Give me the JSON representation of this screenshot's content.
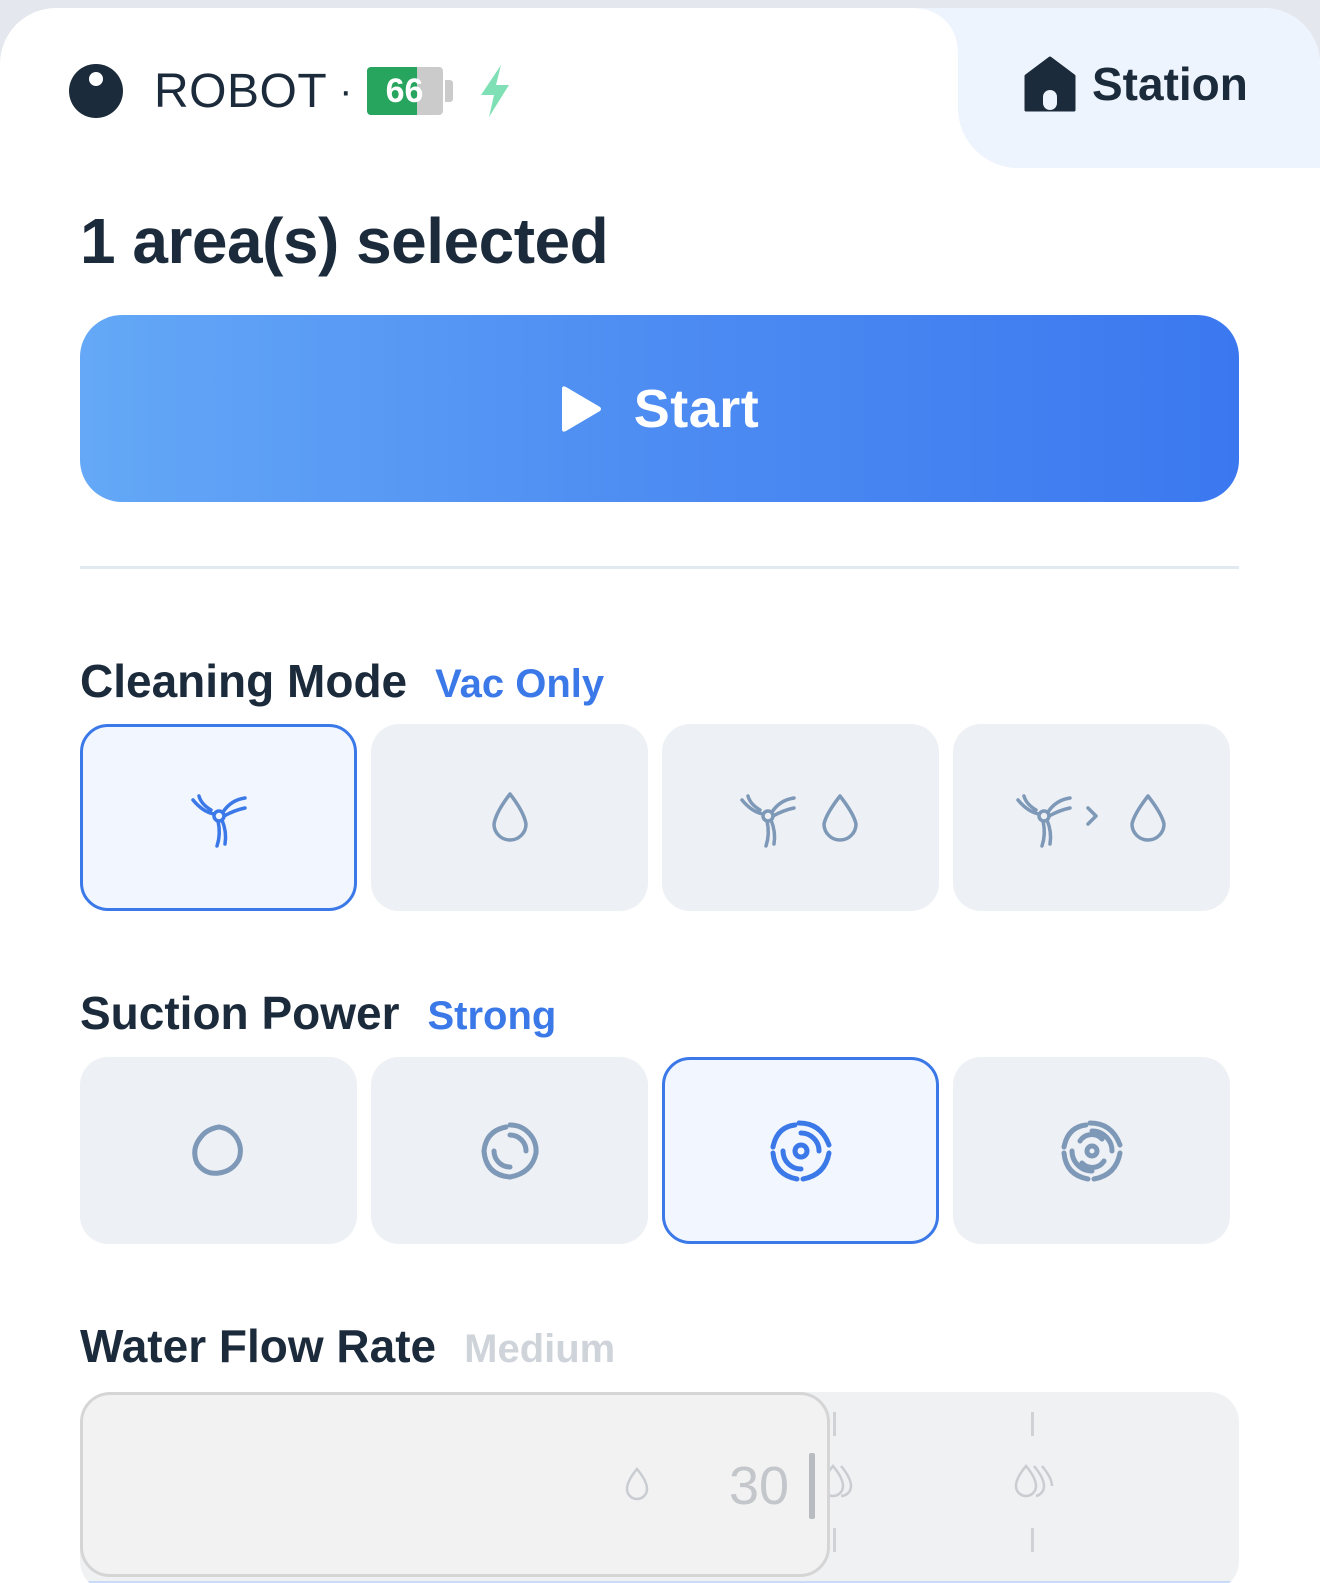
{
  "header": {
    "robot_name": "ROBOT",
    "separator": "·",
    "battery_level": "66",
    "battery_fraction": 0.66,
    "charging": true,
    "station_label": "Station"
  },
  "title": "1 area(s) selected",
  "start_button": {
    "label": "Start"
  },
  "cleaning_mode": {
    "title": "Cleaning Mode",
    "value": "Vac Only",
    "options": [
      {
        "icon": "vacuum-icon",
        "selected": true
      },
      {
        "icon": "mop-drop-icon",
        "selected": false
      },
      {
        "icon": "vacuum-and-mop-icon",
        "selected": false
      },
      {
        "icon": "vacuum-then-mop-icon",
        "selected": false
      }
    ]
  },
  "suction_power": {
    "title": "Suction Power",
    "value": "Strong",
    "options": [
      {
        "icon": "suction-quiet-icon",
        "selected": false
      },
      {
        "icon": "suction-standard-icon",
        "selected": false
      },
      {
        "icon": "suction-strong-icon",
        "selected": true
      },
      {
        "icon": "suction-max-icon",
        "selected": false
      }
    ]
  },
  "water_flow": {
    "title": "Water Flow Rate",
    "value": "Medium",
    "slider_value": "30",
    "icons": [
      "water-low-icon",
      "water-medium-icon",
      "water-high-icon"
    ]
  },
  "colors": {
    "accent": "#3b78e8",
    "text": "#1c2b3b",
    "battery": "#27a55e",
    "bolt": "#7fe0b5"
  }
}
